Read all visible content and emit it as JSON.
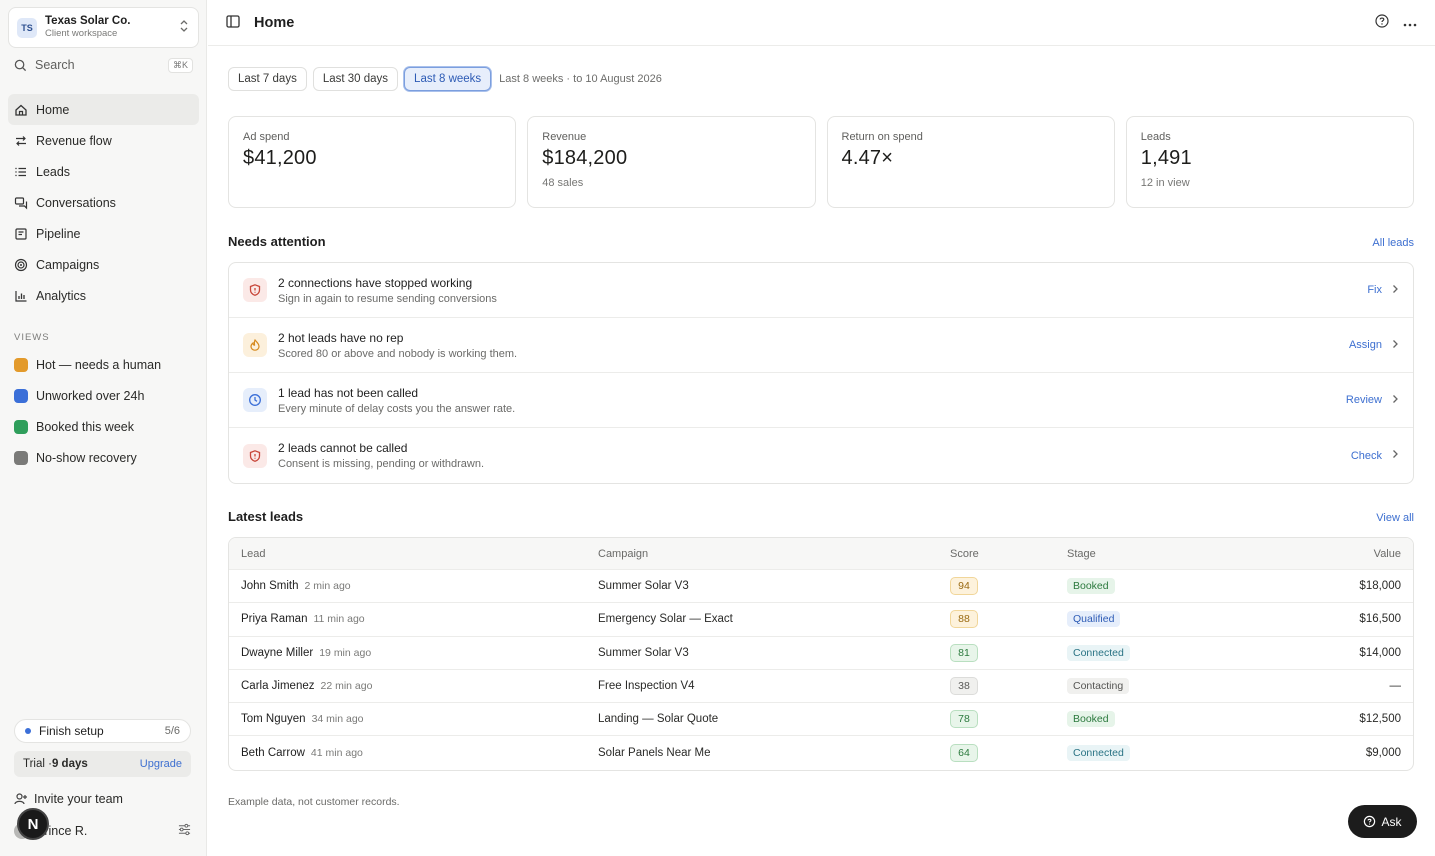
{
  "workspace": {
    "initials": "TS",
    "name": "Texas Solar Co.",
    "subtitle": "Client workspace"
  },
  "search": {
    "label": "Search",
    "shortcut": "⌘K"
  },
  "nav": [
    {
      "label": "Home",
      "icon": "home-icon",
      "active": true
    },
    {
      "label": "Revenue flow",
      "icon": "flow-icon"
    },
    {
      "label": "Leads",
      "icon": "list-icon"
    },
    {
      "label": "Conversations",
      "icon": "chat-icon"
    },
    {
      "label": "Pipeline",
      "icon": "pipeline-icon"
    },
    {
      "label": "Campaigns",
      "icon": "target-icon"
    },
    {
      "label": "Analytics",
      "icon": "chart-icon"
    }
  ],
  "views": {
    "heading": "VIEWS",
    "items": [
      {
        "label": "Hot — needs a human",
        "color": "#e39a2b"
      },
      {
        "label": "Unworked over 24h",
        "color": "#3b6fd8"
      },
      {
        "label": "Booked this week",
        "color": "#2f9e5b"
      },
      {
        "label": "No-show recovery",
        "color": "#7a7a78"
      }
    ]
  },
  "setup": {
    "label": "Finish setup",
    "count": "5/6"
  },
  "trial": {
    "prefix": "Trial · ",
    "days": "9 days",
    "upgrade": "Upgrade"
  },
  "invite": {
    "label": "Invite your team"
  },
  "user": {
    "name": "Prince R."
  },
  "badge": {
    "letter": "N"
  },
  "topbar": {
    "title": "Home"
  },
  "ranges": {
    "options": [
      "Last 7 days",
      "Last 30 days",
      "Last 8 weeks"
    ],
    "selected": "Last 8 weeks",
    "note": "Last 8 weeks · to 10 August 2026"
  },
  "kpis": [
    {
      "label": "Ad spend",
      "value": "$41,200",
      "sub": ""
    },
    {
      "label": "Revenue",
      "value": "$184,200",
      "sub": "48 sales"
    },
    {
      "label": "Return on spend",
      "value": "4.47×",
      "sub": ""
    },
    {
      "label": "Leads",
      "value": "1,491",
      "sub": "12 in view"
    }
  ],
  "attention": {
    "title": "Needs attention",
    "link": "All leads",
    "items": [
      {
        "title": "2 connections have stopped working",
        "sub": "Sign in again to resume sending conversions",
        "action": "Fix",
        "icon": "shield-icon",
        "bg": "#fbe9e7",
        "fg": "#c8473a"
      },
      {
        "title": "2 hot leads have no rep",
        "sub": "Scored 80 or above and nobody is working them.",
        "action": "Assign",
        "icon": "flame-icon",
        "bg": "#fcf0dc",
        "fg": "#d68a1e"
      },
      {
        "title": "1 lead has not been called",
        "sub": "Every minute of delay costs you the answer rate.",
        "action": "Review",
        "icon": "clock-icon",
        "bg": "#e6eefb",
        "fg": "#3b6fd8"
      },
      {
        "title": "2 leads cannot be called",
        "sub": "Consent is missing, pending or withdrawn.",
        "action": "Check",
        "icon": "shield-icon",
        "bg": "#fbe9e7",
        "fg": "#c8473a"
      }
    ]
  },
  "leads": {
    "title": "Latest leads",
    "link": "View all",
    "columns": [
      "Lead",
      "Campaign",
      "Score",
      "Stage",
      "Value"
    ],
    "rows": [
      {
        "name": "John Smith",
        "time": "2 min ago",
        "campaign": "Summer Solar V3",
        "score": "94",
        "stage": "Booked",
        "value": "$18,000"
      },
      {
        "name": "Priya Raman",
        "time": "11 min ago",
        "campaign": "Emergency Solar — Exact",
        "score": "88",
        "stage": "Qualified",
        "value": "$16,500"
      },
      {
        "name": "Dwayne Miller",
        "time": "19 min ago",
        "campaign": "Summer Solar V3",
        "score": "81",
        "stage": "Connected",
        "value": "$14,000"
      },
      {
        "name": "Carla Jimenez",
        "time": "22 min ago",
        "campaign": "Free Inspection V4",
        "score": "38",
        "stage": "Contacting",
        "value": "—"
      },
      {
        "name": "Tom Nguyen",
        "time": "34 min ago",
        "campaign": "Landing — Solar Quote",
        "score": "78",
        "stage": "Booked",
        "value": "$12,500"
      },
      {
        "name": "Beth Carrow",
        "time": "41 min ago",
        "campaign": "Solar Panels Near Me",
        "score": "64",
        "stage": "Connected",
        "value": "$9,000"
      }
    ]
  },
  "footnote": "Example data, not customer records.",
  "ask": {
    "label": "Ask"
  }
}
